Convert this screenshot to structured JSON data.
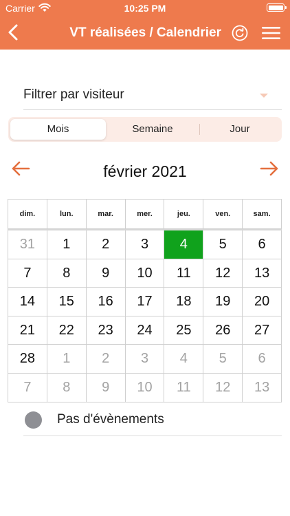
{
  "colors": {
    "header": "#ee7a4d",
    "accent": "#e4703f",
    "today": "#10a21c",
    "segment_bg": "#fcece6",
    "event_dot": "#8e8f94"
  },
  "status_bar": {
    "carrier": "Carrier",
    "time": "10:25 PM",
    "wifi_icon": "wifi-icon",
    "battery_icon": "battery-icon"
  },
  "nav": {
    "back_icon": "chevron-left-icon",
    "title": "VT réalisées / Calendrier",
    "refresh_icon": "refresh-icon",
    "menu_icon": "hamburger-menu-icon"
  },
  "filter": {
    "placeholder": "Filtrer par visiteur",
    "caret_icon": "caret-down-icon"
  },
  "segments": [
    {
      "label": "Mois",
      "active": true
    },
    {
      "label": "Semaine",
      "active": false
    },
    {
      "label": "Jour",
      "active": false
    }
  ],
  "calendar": {
    "month_title": "février 2021",
    "prev_icon": "arrow-left-icon",
    "next_icon": "arrow-right-icon",
    "weekdays": [
      "dim.",
      "lun.",
      "mar.",
      "mer.",
      "jeu.",
      "ven.",
      "sam."
    ],
    "weeks": [
      [
        {
          "d": "31",
          "m": true
        },
        {
          "d": "1"
        },
        {
          "d": "2"
        },
        {
          "d": "3"
        },
        {
          "d": "4",
          "today": true
        },
        {
          "d": "5"
        },
        {
          "d": "6"
        }
      ],
      [
        {
          "d": "7"
        },
        {
          "d": "8"
        },
        {
          "d": "9"
        },
        {
          "d": "10"
        },
        {
          "d": "11"
        },
        {
          "d": "12"
        },
        {
          "d": "13"
        }
      ],
      [
        {
          "d": "14"
        },
        {
          "d": "15"
        },
        {
          "d": "16"
        },
        {
          "d": "17"
        },
        {
          "d": "18"
        },
        {
          "d": "19"
        },
        {
          "d": "20"
        }
      ],
      [
        {
          "d": "21"
        },
        {
          "d": "22"
        },
        {
          "d": "23"
        },
        {
          "d": "24"
        },
        {
          "d": "25"
        },
        {
          "d": "26"
        },
        {
          "d": "27"
        }
      ],
      [
        {
          "d": "28"
        },
        {
          "d": "1",
          "m": true
        },
        {
          "d": "2",
          "m": true
        },
        {
          "d": "3",
          "m": true
        },
        {
          "d": "4",
          "m": true
        },
        {
          "d": "5",
          "m": true
        },
        {
          "d": "6",
          "m": true
        }
      ],
      [
        {
          "d": "7",
          "m": true
        },
        {
          "d": "8",
          "m": true
        },
        {
          "d": "9",
          "m": true
        },
        {
          "d": "10",
          "m": true
        },
        {
          "d": "11",
          "m": true
        },
        {
          "d": "12",
          "m": true
        },
        {
          "d": "13",
          "m": true
        }
      ]
    ]
  },
  "events": {
    "empty_label": "Pas d'évènements"
  }
}
